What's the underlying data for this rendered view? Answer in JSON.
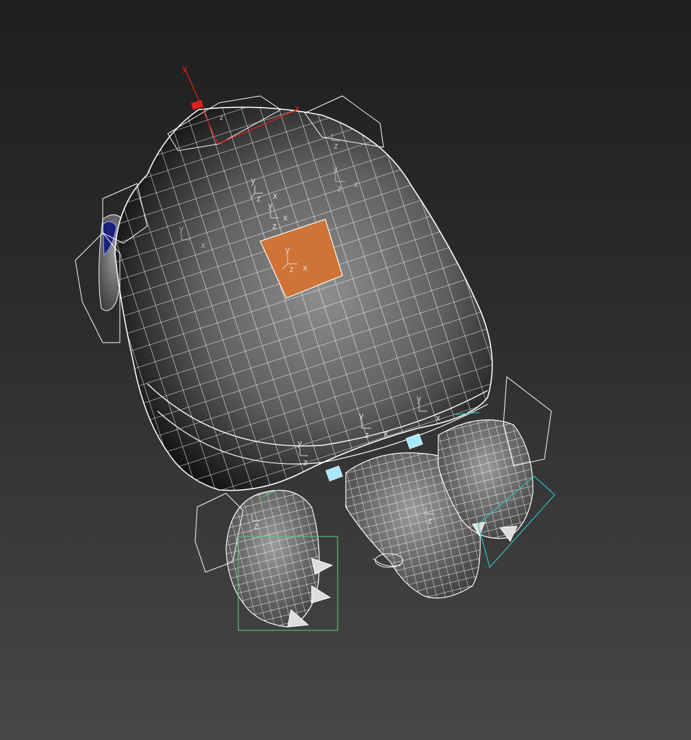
{
  "viewport": {
    "background_top": "#1f1f1f",
    "background_bottom": "#474747",
    "wire_color": "#ffffff",
    "selection_color": "#cf7436",
    "axis_x_label": "x",
    "axis_y_label": "y",
    "axis_z_label": "z"
  },
  "icons": [
    "transform-gizmo-icon",
    "bone-pivot-icon",
    "helper-cube-icon"
  ]
}
